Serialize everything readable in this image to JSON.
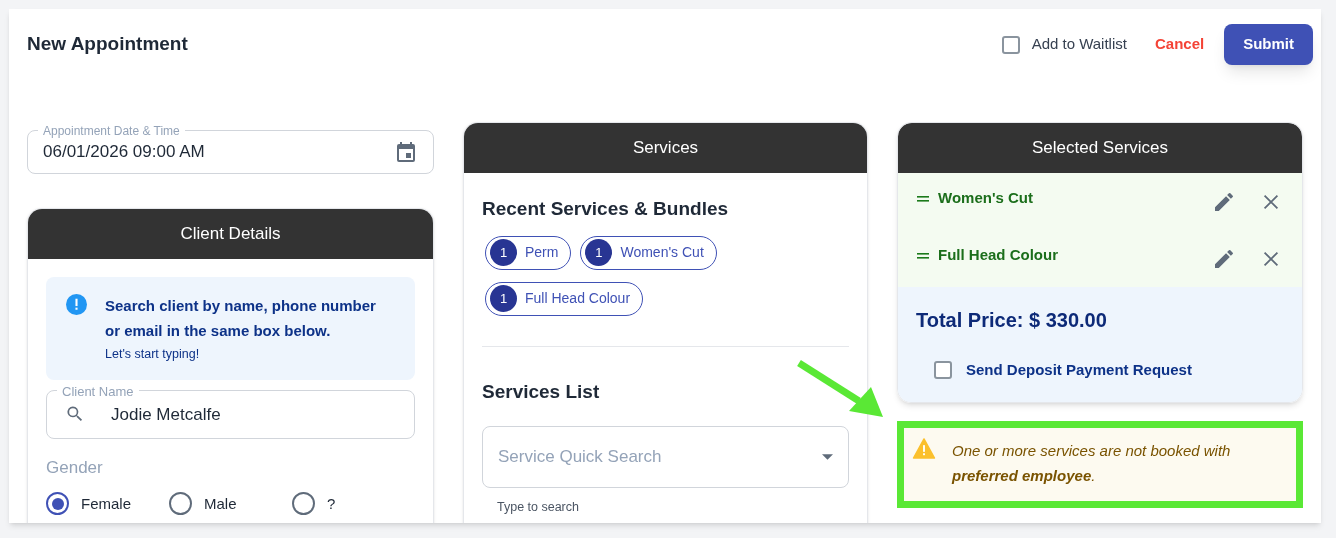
{
  "header": {
    "title": "New Appointment",
    "waitlist": {
      "label": "Add to Waitlist",
      "checked": false
    },
    "cancel": "Cancel",
    "submit": "Submit"
  },
  "date_field": {
    "label": "Appointment Date & Time",
    "value": "06/01/2026 09:00 AM"
  },
  "client_details": {
    "title": "Client Details",
    "info": {
      "message": "Search client by name, phone number or email in the same box below.",
      "hint": "Let's start typing!"
    },
    "client_name": {
      "label": "Client Name",
      "value": "Jodie Metcalfe"
    },
    "gender": {
      "label": "Gender",
      "options": [
        {
          "label": "Female",
          "selected": true
        },
        {
          "label": "Male",
          "selected": false
        },
        {
          "label": "?",
          "selected": false
        }
      ]
    }
  },
  "services": {
    "title": "Services",
    "recent_heading": "Recent Services & Bundles",
    "recent": [
      {
        "count": "1",
        "label": "Perm"
      },
      {
        "count": "1",
        "label": "Women's Cut"
      },
      {
        "count": "1",
        "label": "Full Head Colour"
      }
    ],
    "list_heading": "Services List",
    "quick_search": {
      "placeholder": "Service Quick Search"
    },
    "type_to_search": "Type to search"
  },
  "selected_services": {
    "title": "Selected Services",
    "items": [
      {
        "name": "Women's Cut"
      },
      {
        "name": "Full Head Colour"
      }
    ],
    "total": "Total Price: $ 330.00",
    "deposit": {
      "label": "Send Deposit Payment Request",
      "checked": false
    }
  },
  "warning": {
    "message": "One or more services are not booked with **preferred employee**."
  }
}
